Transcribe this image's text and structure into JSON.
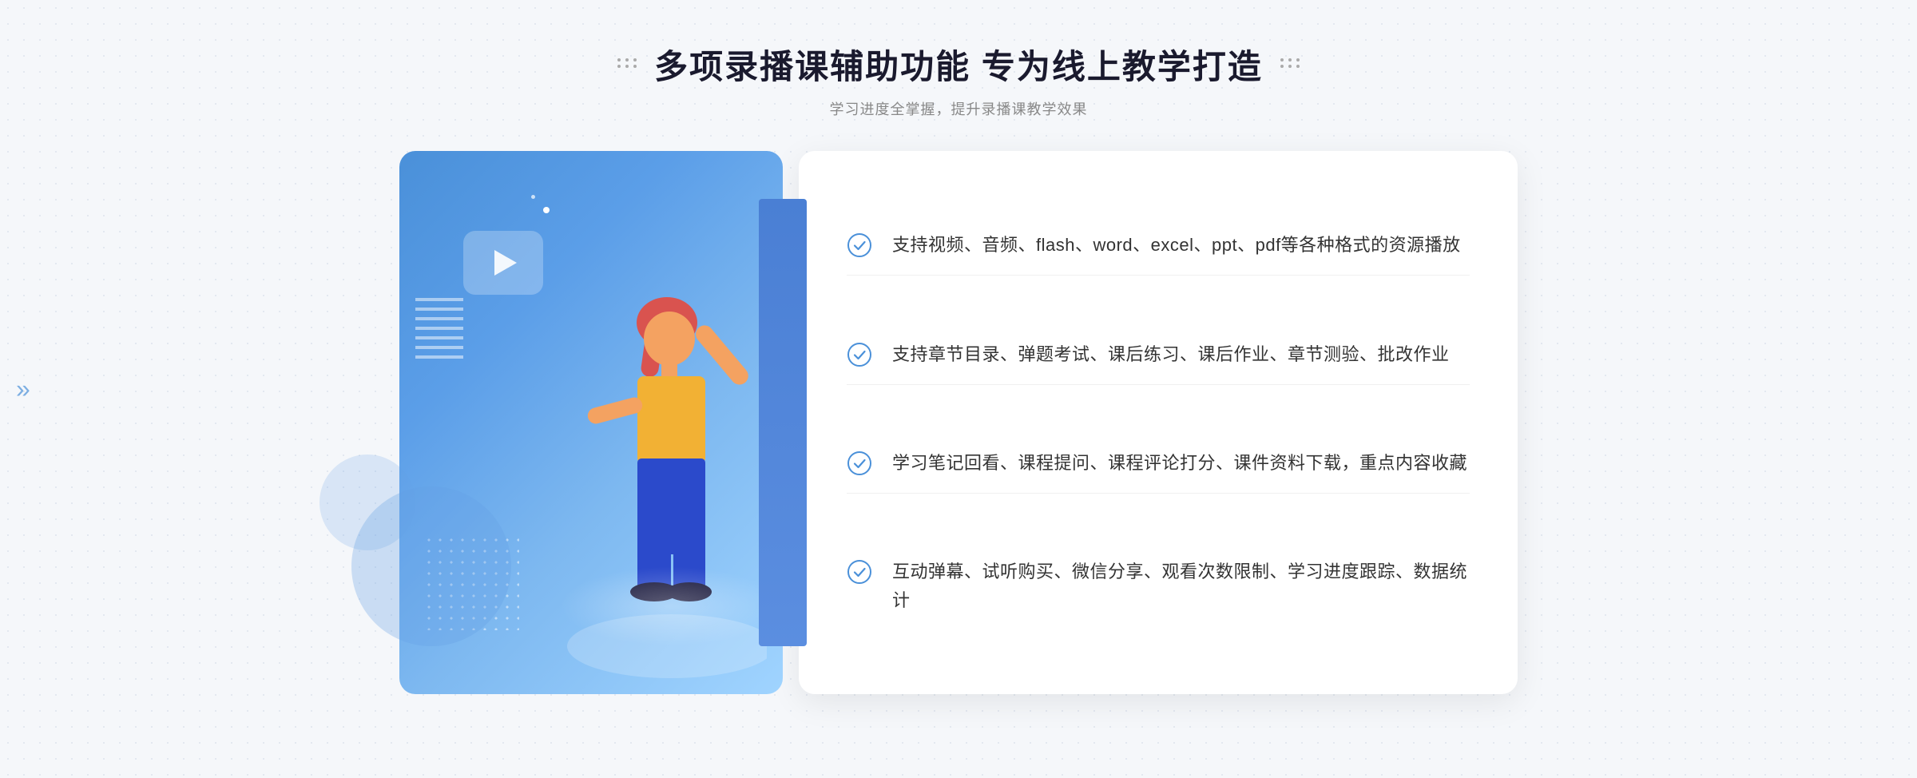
{
  "page": {
    "background": "#f5f7fa"
  },
  "header": {
    "title": "多项录播课辅助功能 专为线上教学打造",
    "subtitle": "学习进度全掌握，提升录播课教学效果",
    "title_dots_left": "decorative",
    "title_dots_right": "decorative"
  },
  "features": [
    {
      "id": 1,
      "text": "支持视频、音频、flash、word、excel、ppt、pdf等各种格式的资源播放"
    },
    {
      "id": 2,
      "text": "支持章节目录、弹题考试、课后练习、课后作业、章节测验、批改作业"
    },
    {
      "id": 3,
      "text": "学习笔记回看、课程提问、课程评论打分、课件资料下载，重点内容收藏"
    },
    {
      "id": 4,
      "text": "互动弹幕、试听购买、微信分享、观看次数限制、学习进度跟踪、数据统计"
    }
  ],
  "check_icon_color": "#4a90d9",
  "accent_color": "#4a90d9"
}
